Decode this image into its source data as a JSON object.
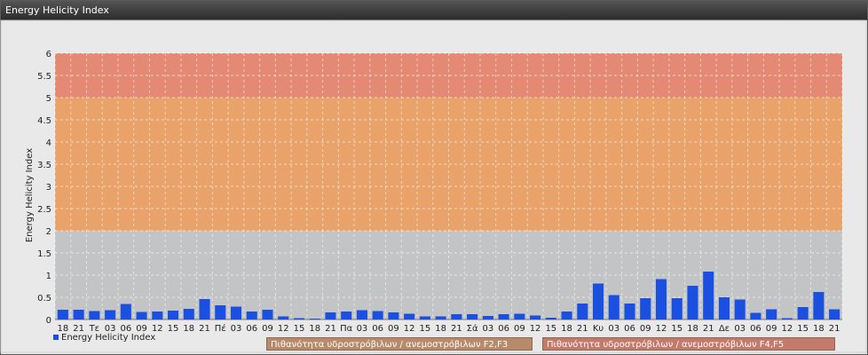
{
  "window": {
    "title": "Energy Helicity Index"
  },
  "colors": {
    "bar": "#1a4fe0",
    "zone_low": "#c2c4c6",
    "zone_mid": "#e8a26a",
    "zone_high": "#e48a74",
    "legend_f2f3": "#b78a6a",
    "legend_f4f5": "#c47a6a"
  },
  "chart_data": {
    "type": "bar",
    "title": "Energy Helicity Index",
    "ylabel": "Energy Helicity Index",
    "xlabel": "",
    "ylim": [
      0,
      6
    ],
    "yticks": [
      "0",
      "0.5",
      "1",
      "1.5",
      "2",
      "2.5",
      "3",
      "3.5",
      "4",
      "4.5",
      "5",
      "5.5",
      "6"
    ],
    "grid": true,
    "categories": [
      "18",
      "21",
      "Τε",
      "03",
      "06",
      "09",
      "12",
      "15",
      "18",
      "21",
      "Πέ",
      "03",
      "06",
      "09",
      "12",
      "15",
      "18",
      "21",
      "Πα",
      "03",
      "06",
      "09",
      "12",
      "15",
      "18",
      "21",
      "Σά",
      "03",
      "06",
      "09",
      "12",
      "15",
      "18",
      "21",
      "Κυ",
      "03",
      "06",
      "09",
      "12",
      "15",
      "18",
      "21",
      "Δε",
      "03",
      "06",
      "09",
      "12",
      "15",
      "18",
      "21"
    ],
    "series": [
      {
        "name": "Energy Helicity Index",
        "values": [
          0.22,
          0.22,
          0.19,
          0.21,
          0.35,
          0.17,
          0.18,
          0.2,
          0.24,
          0.46,
          0.32,
          0.29,
          0.18,
          0.22,
          0.07,
          0.03,
          0.02,
          0.16,
          0.18,
          0.21,
          0.19,
          0.16,
          0.13,
          0.07,
          0.07,
          0.12,
          0.12,
          0.08,
          0.12,
          0.13,
          0.09,
          0.04,
          0.18,
          0.36,
          0.81,
          0.55,
          0.36,
          0.48,
          0.91,
          0.48,
          0.76,
          1.08,
          0.5,
          0.45,
          0.15,
          0.23,
          0.03,
          0.28,
          0.62,
          0.23
        ]
      }
    ],
    "zones": [
      {
        "from": 0,
        "to": 2,
        "color": "#c2c4c6"
      },
      {
        "from": 2,
        "to": 5,
        "color": "#e8a26a"
      },
      {
        "from": 5,
        "to": 6,
        "color": "#e48a74"
      }
    ],
    "legend": {
      "placement": "bottom",
      "entries": [
        "Energy Helicity Index",
        "Πιθανότητα υδροστρόβιλων / ανεμοστρόβιλων F2,F3",
        "Πιθανότητα υδροστρόβιλων / ανεμοστρόβιλων F4,F5"
      ]
    }
  }
}
